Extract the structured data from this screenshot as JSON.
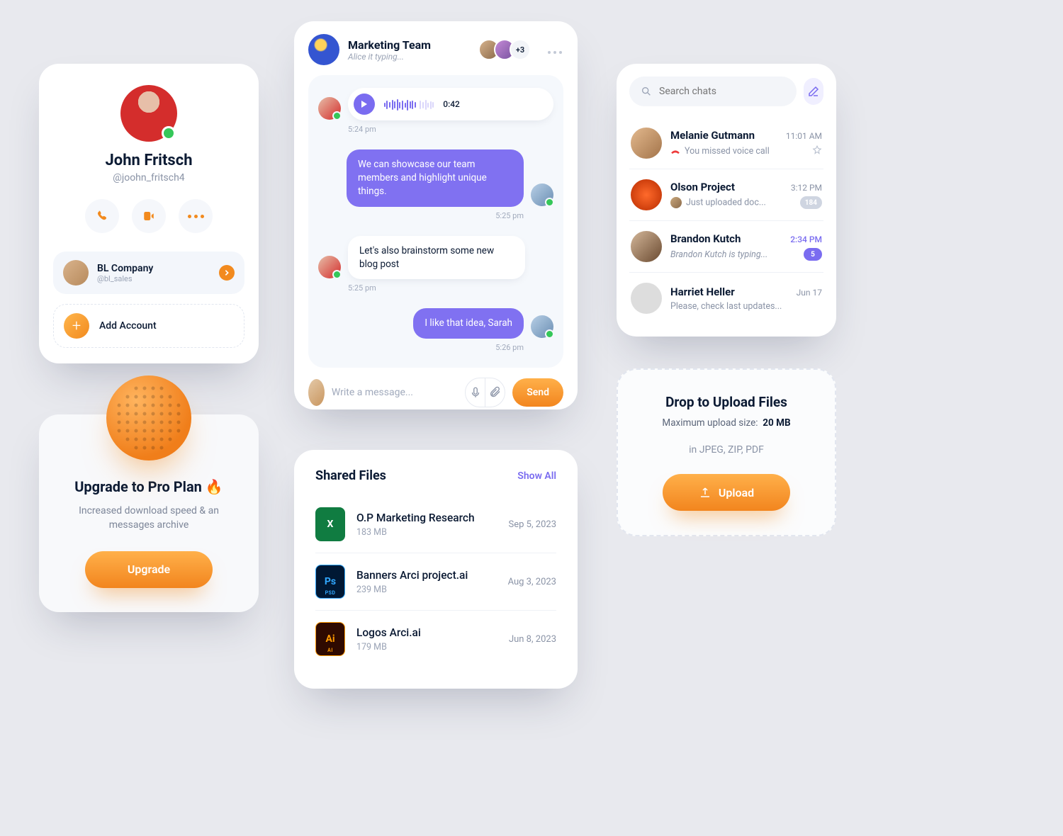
{
  "profile": {
    "name": "John Fritsch",
    "handle": "@joohn_fritsch4",
    "actions": {
      "call": "call-icon",
      "video": "video-icon",
      "more": "more-icon"
    },
    "account": {
      "name": "BL Company",
      "handle": "@bl_sales"
    },
    "add_label": "Add Account"
  },
  "upgrade": {
    "title": "Upgrade to Pro Plan 🔥",
    "subtitle": "Increased download speed & an messages archive",
    "button": "Upgrade"
  },
  "chat": {
    "title": "Marketing Team",
    "typing": "Alice it typing...",
    "extra_count": "+3",
    "messages": [
      {
        "dir": "in",
        "type": "voice",
        "duration": "0:42",
        "time": "5:24 pm"
      },
      {
        "dir": "out",
        "type": "text",
        "text": "We can showcase our team members and highlight unique things.",
        "time": "5:25 pm"
      },
      {
        "dir": "in",
        "type": "text",
        "text": "Let's also brainstorm some new blog post",
        "time": "5:25 pm"
      },
      {
        "dir": "out",
        "type": "text",
        "text": "I like that idea, Sarah",
        "time": "5:26 pm"
      }
    ],
    "composer": {
      "placeholder": "Write a message...",
      "send": "Send"
    }
  },
  "files": {
    "title": "Shared Files",
    "show_all": "Show All",
    "items": [
      {
        "icon": "xl",
        "glyph": "X",
        "name": "O.P Marketing Research",
        "size": "183 MB",
        "date": "Sep 5, 2023"
      },
      {
        "icon": "ps",
        "glyph": "Ps",
        "ext": "PSD",
        "name": "Banners Arci project.ai",
        "size": "239 MB",
        "date": "Aug 3, 2023"
      },
      {
        "icon": "ai",
        "glyph": "Ai",
        "ext": "AI",
        "name": "Logos Arci.ai",
        "size": "179 MB",
        "date": "Jun 8, 2023"
      }
    ]
  },
  "chats": {
    "search_placeholder": "Search chats",
    "items": [
      {
        "name": "Melanie Gutmann",
        "time": "11:01 AM",
        "sub": "You missed voice call",
        "kind": "missed",
        "right": "pin"
      },
      {
        "name": "Olson Project",
        "time": "3:12 PM",
        "sub": "Just uploaded doc...",
        "kind": "avatar",
        "right": "badge",
        "badge": "184"
      },
      {
        "name": "Brandon Kutch",
        "time": "2:34 PM",
        "sub": "Brandon Kutch is typing...",
        "kind": "typing",
        "right": "badge_purple",
        "badge": "5",
        "time_style": "purp"
      },
      {
        "name": "Harriet Heller",
        "time": "Jun 17",
        "sub": "Please, check last updates...",
        "kind": "plain"
      }
    ]
  },
  "upload": {
    "title": "Drop to Upload Files",
    "max_label": "Maximum upload size:",
    "max_value": "20 MB",
    "formats": "in JPEG, ZIP, PDF",
    "button": "Upload"
  }
}
